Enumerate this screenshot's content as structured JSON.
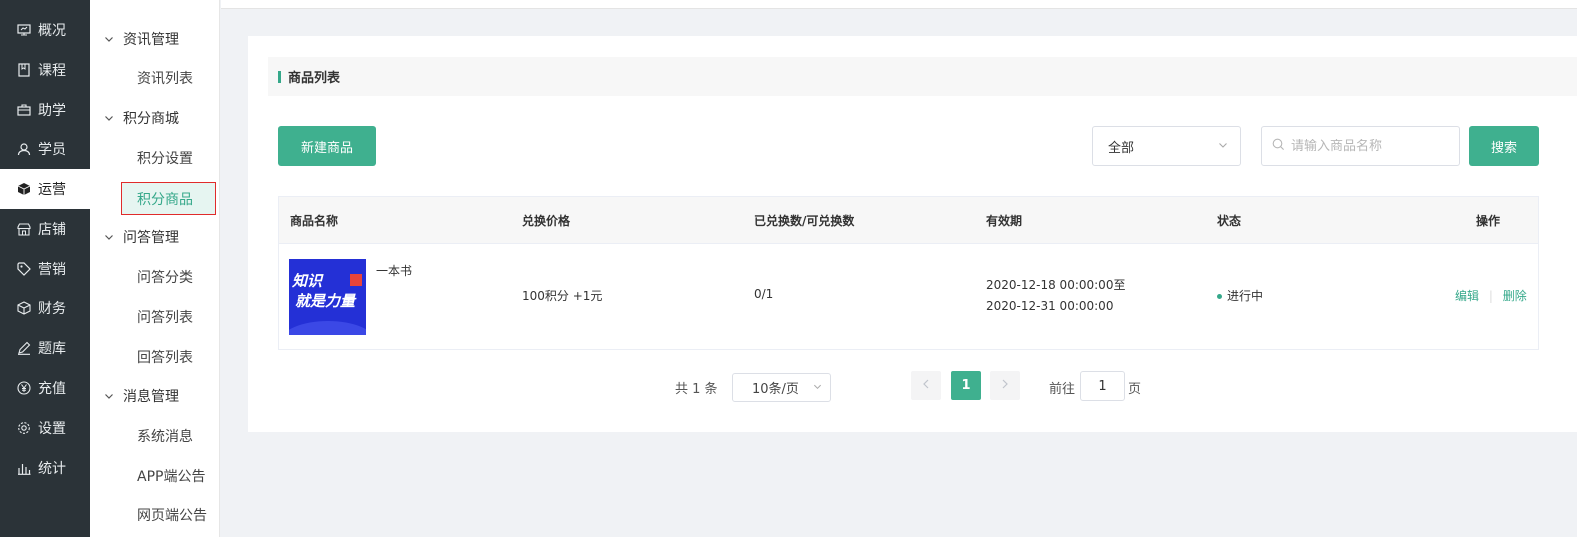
{
  "nav": {
    "items": [
      {
        "label": "概况",
        "icon": "overview-icon"
      },
      {
        "label": "课程",
        "icon": "book-icon"
      },
      {
        "label": "助学",
        "icon": "briefcase-icon"
      },
      {
        "label": "学员",
        "icon": "user-icon"
      },
      {
        "label": "运营",
        "icon": "cube-icon",
        "active": true
      },
      {
        "label": "店铺",
        "icon": "store-icon"
      },
      {
        "label": "营销",
        "icon": "tag-icon"
      },
      {
        "label": "财务",
        "icon": "box-icon"
      },
      {
        "label": "题库",
        "icon": "pen-icon"
      },
      {
        "label": "充值",
        "icon": "yuan-icon"
      },
      {
        "label": "设置",
        "icon": "gear-icon"
      },
      {
        "label": "统计",
        "icon": "bar-chart-icon"
      }
    ]
  },
  "submenu": {
    "news_group": "资讯管理",
    "news_list": "资讯列表",
    "points_group": "积分商城",
    "points_settings": "积分设置",
    "points_goods": "积分商品",
    "qa_group": "问答管理",
    "qa_category": "问答分类",
    "qa_list": "问答列表",
    "answer_list": "回答列表",
    "msg_group": "消息管理",
    "system_msg": "系统消息",
    "app_notice": "APP端公告",
    "web_notice": "网页端公告"
  },
  "main": {
    "title": "商品列表",
    "new_button": "新建商品",
    "filter_value": "全部",
    "search_placeholder": "请输入商品名称",
    "search_button": "搜索"
  },
  "table": {
    "columns": [
      "商品名称",
      "兑换价格",
      "已兑换数/可兑换数",
      "有效期",
      "状态",
      "操作"
    ],
    "rows": [
      {
        "name": "一本书",
        "thumb_line1": "知识",
        "thumb_line2": "就是力量",
        "price": "100积分 +1元",
        "exchanged": "0/1",
        "valid_from": "2020-12-18 00:00:00至",
        "valid_to": "2020-12-31 00:00:00",
        "status": "进行中",
        "edit": "编辑",
        "delete": "删除"
      }
    ]
  },
  "pagination": {
    "total": "共 1 条",
    "page_size": "10条/页",
    "current": "1",
    "goto_prefix": "前往",
    "goto_value": "1",
    "goto_suffix": "页"
  },
  "colors": {
    "accent": "#3fb08f",
    "sidebar": "#2b3338",
    "highlight_border": "#e02b2b"
  }
}
